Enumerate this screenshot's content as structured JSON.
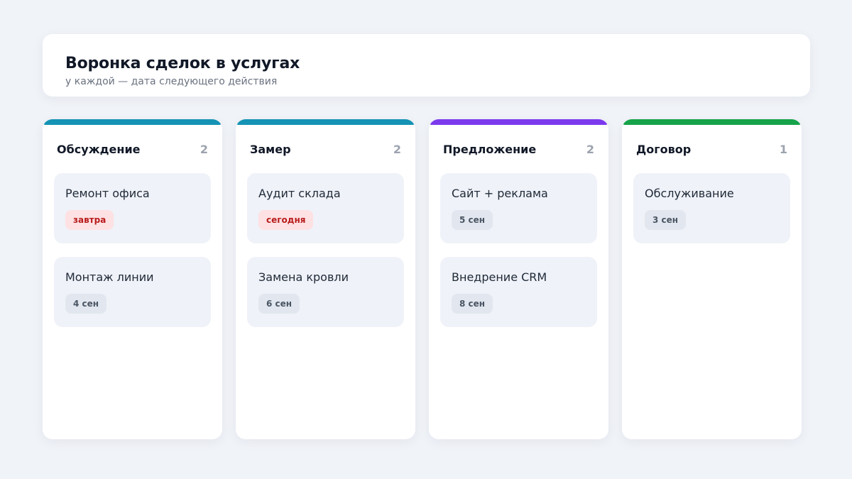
{
  "header": {
    "title": "Воронка сделок в услугах",
    "subtitle": "у каждой — дата следующего действия"
  },
  "columns": [
    {
      "title": "Обсуждение",
      "count": "2",
      "accent": "#1593b4",
      "cards": [
        {
          "title": "Ремонт офиса",
          "due": "завтра",
          "urgent": true
        },
        {
          "title": "Монтаж линии",
          "due": "4 сен",
          "urgent": false
        }
      ]
    },
    {
      "title": "Замер",
      "count": "2",
      "accent": "#1593b4",
      "cards": [
        {
          "title": "Аудит склада",
          "due": "сегодня",
          "urgent": true
        },
        {
          "title": "Замена кровли",
          "due": "6 сен",
          "urgent": false
        }
      ]
    },
    {
      "title": "Предложение",
      "count": "2",
      "accent": "#7c3aed",
      "cards": [
        {
          "title": "Сайт + реклама",
          "due": "5 сен",
          "urgent": false
        },
        {
          "title": "Внедрение CRM",
          "due": "8 сен",
          "urgent": false
        }
      ]
    },
    {
      "title": "Договор",
      "count": "1",
      "accent": "#16a34a",
      "cards": [
        {
          "title": "Обслуживание",
          "due": "3 сен",
          "urgent": false
        }
      ]
    }
  ]
}
